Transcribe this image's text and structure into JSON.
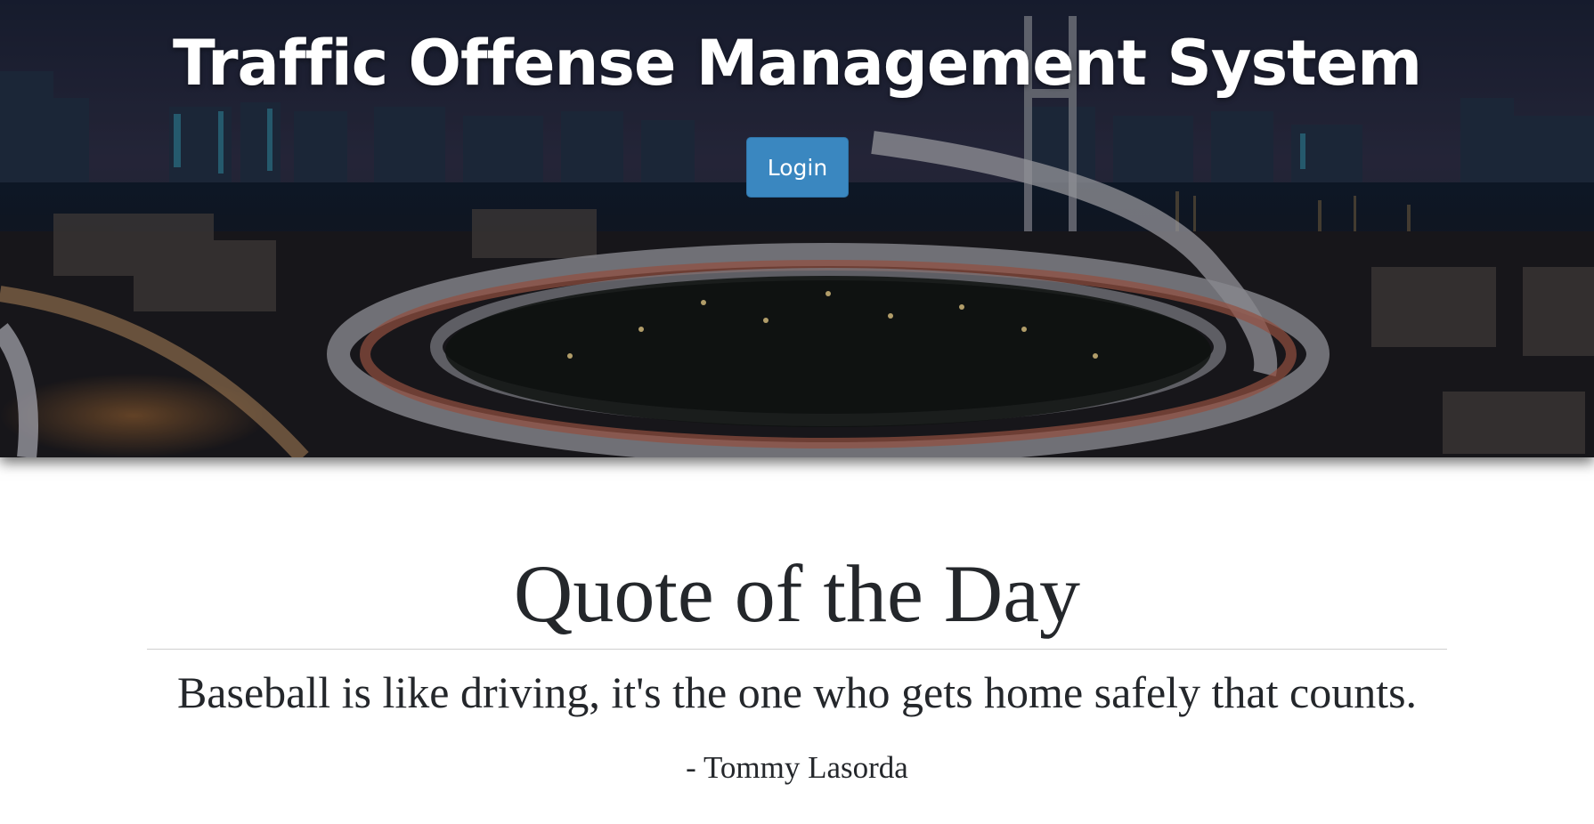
{
  "header": {
    "title": "Traffic Offense Management System",
    "login_label": "Login"
  },
  "quote": {
    "heading": "Quote of the Day",
    "text": "Baseball is like driving, it's the one who gets home safely that counts.",
    "author": "- Tommy Lasorda"
  },
  "colors": {
    "login_button": "#3a87c0",
    "text_dark": "#24272b",
    "divider": "#cfcfcf"
  }
}
